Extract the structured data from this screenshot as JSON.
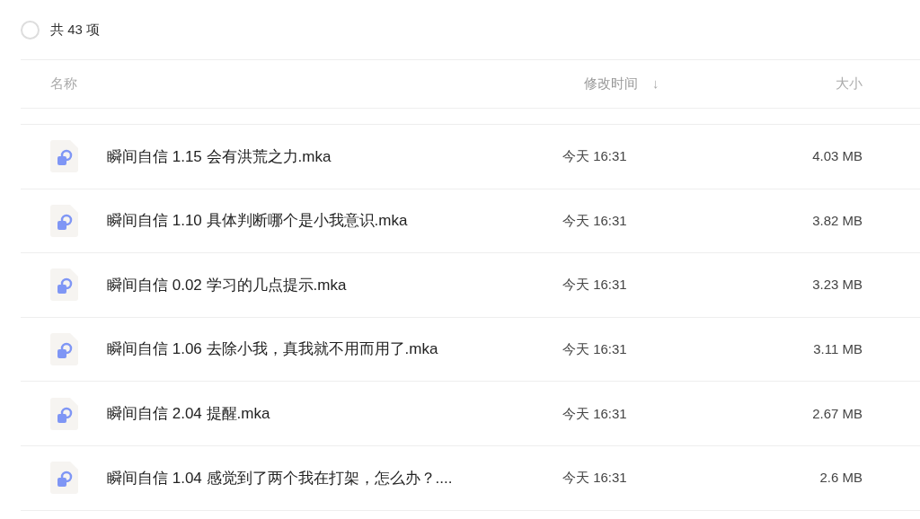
{
  "select_all": {
    "checked": false,
    "label": "共 43 项"
  },
  "table": {
    "columns": [
      {
        "label": "名称",
        "sorted": false
      },
      {
        "label": "修改时间",
        "sorted": true,
        "sort_icon": "↓"
      },
      {
        "label": "大小",
        "sorted": false
      }
    ],
    "rows": [
      {
        "name": "瞬间自信 1.15 会有洪荒之力.mka",
        "modified": "今天 16:31",
        "size": "4.03 MB"
      },
      {
        "name": "瞬间自信 1.10 具体判断哪个是小我意识.mka",
        "modified": "今天 16:31",
        "size": "3.82 MB"
      },
      {
        "name": "瞬间自信 0.02 学习的几点提示.mka",
        "modified": "今天 16:31",
        "size": "3.23 MB"
      },
      {
        "name": "瞬间自信 1.06 去除小我，真我就不用而用了.mka",
        "modified": "今天 16:31",
        "size": "3.11 MB"
      },
      {
        "name": "瞬间自信 2.04 提醒.mka",
        "modified": "今天 16:31",
        "size": "2.67 MB"
      },
      {
        "name": "瞬间自信 1.04 感觉到了两个我在打架，怎么办？....",
        "modified": "今天 16:31",
        "size": "2.6 MB"
      }
    ]
  }
}
